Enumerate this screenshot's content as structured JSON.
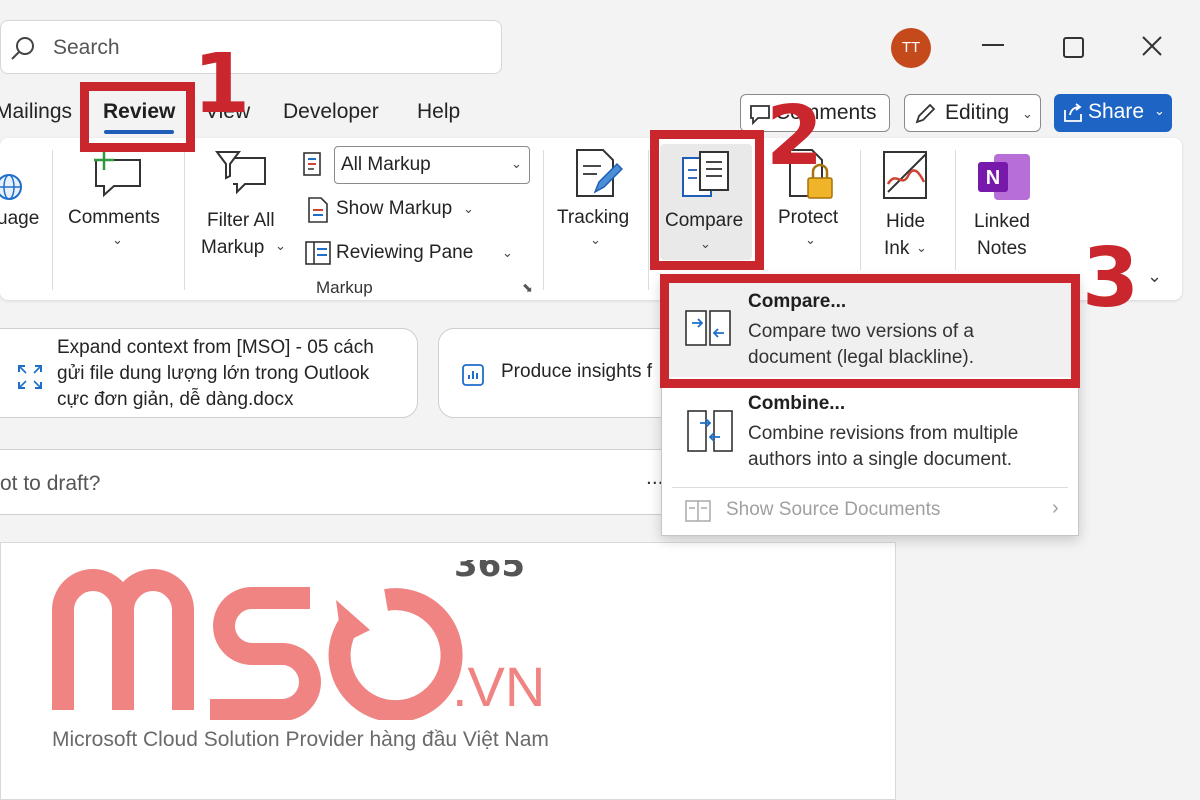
{
  "titlebar": {
    "search_placeholder": "Search",
    "avatar_initials": "TT"
  },
  "tabs": [
    "Mailings",
    "Review",
    "View",
    "Developer",
    "Help"
  ],
  "top_buttons": {
    "comments": "Comments",
    "editing": "Editing",
    "share": "Share"
  },
  "ribbon": {
    "language": "uage",
    "comments": "Comments",
    "filter_all_line1": "Filter All",
    "filter_all_line2": "Markup",
    "markup_combo_value": "All Markup",
    "show_markup": "Show Markup",
    "reviewing_pane": "Reviewing Pane",
    "markup_group": "Markup",
    "tracking": "Tracking",
    "compare": "Compare",
    "protect": "Protect",
    "hide_ink_line1": "Hide",
    "hide_ink_line2": "Ink",
    "linked_notes_line1": "Linked",
    "linked_notes_line2": "Notes"
  },
  "content": {
    "card1_line1": "Expand context from [MSO] - 05 cách",
    "card1_line2": "gửi file dung lượng lớn trong Outlook",
    "card1_line3": "cực đơn giản, dễ dàng.docx",
    "card2": "Produce insights f",
    "draft_prompt": "ot to draft?",
    "more": "..."
  },
  "dropdown": {
    "compare_title": "Compare...",
    "compare_desc1": "Compare two versions of a",
    "compare_desc2": "document (legal blackline).",
    "combine_title": "Combine...",
    "combine_desc1": "Combine revisions from multiple",
    "combine_desc2": "authors into a single document.",
    "show_source": "Show Source Documents"
  },
  "annotations": {
    "step1": "1",
    "step2": "2",
    "step3": "3"
  },
  "watermark": {
    "brand": "MSO",
    "sup": "365",
    "domain": ".VN",
    "tagline": "Microsoft Cloud Solution Provider hàng đầu Việt Nam"
  },
  "colors": {
    "accent": "#1f5eb8",
    "share": "#1d64c4",
    "annotation_red": "#c9262d",
    "watermark_pink": "#ef8482",
    "avatar": "#c44a1c"
  }
}
